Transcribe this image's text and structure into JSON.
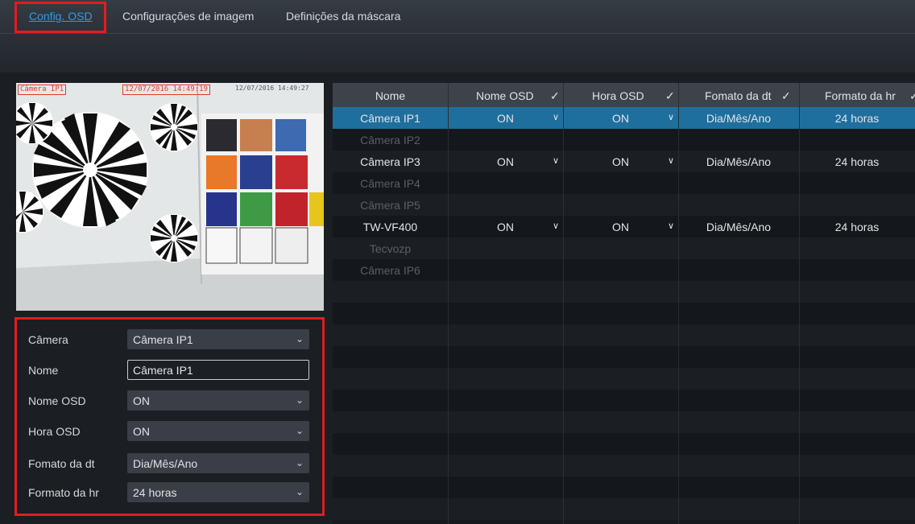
{
  "tabs": [
    {
      "label": "Config. OSD",
      "active": true
    },
    {
      "label": "Configurações de imagem",
      "active": false
    },
    {
      "label": "Definições da máscara",
      "active": false
    }
  ],
  "preview": {
    "osd_name": "Câmera IP1",
    "osd_time": "12/07/2016 14:49:19",
    "camera_timestamp": "12/07/2016 14:49:27"
  },
  "form": {
    "camera": {
      "label": "Câmera",
      "value": "Câmera IP1"
    },
    "name": {
      "label": "Nome",
      "value": "Câmera IP1"
    },
    "osd_name": {
      "label": "Nome OSD",
      "value": "ON"
    },
    "osd_time": {
      "label": "Hora OSD",
      "value": "ON"
    },
    "date_format": {
      "label": "Fomato da dt",
      "value": "Dia/Mês/Ano"
    },
    "time_format": {
      "label": "Formato da hr",
      "value": "24 horas"
    }
  },
  "table": {
    "headers": [
      "Nome",
      "Nome OSD",
      "Hora OSD",
      "Fomato da dt",
      "Formato da hr"
    ],
    "rows": [
      {
        "name": "Câmera IP1",
        "osd_name": "ON",
        "osd_time": "ON",
        "date_format": "Dia/Mês/Ano",
        "time_format": "24 horas",
        "selected": true,
        "online": true
      },
      {
        "name": "Câmera IP2",
        "osd_name": "",
        "osd_time": "",
        "date_format": "",
        "time_format": "",
        "selected": false,
        "online": false
      },
      {
        "name": "Câmera IP3",
        "osd_name": "ON",
        "osd_time": "ON",
        "date_format": "Dia/Mês/Ano",
        "time_format": "24 horas",
        "selected": false,
        "online": true
      },
      {
        "name": "Câmera IP4",
        "osd_name": "",
        "osd_time": "",
        "date_format": "",
        "time_format": "",
        "selected": false,
        "online": false
      },
      {
        "name": "Câmera IP5",
        "osd_name": "",
        "osd_time": "",
        "date_format": "",
        "time_format": "",
        "selected": false,
        "online": false
      },
      {
        "name": "TW-VF400",
        "osd_name": "ON",
        "osd_time": "ON",
        "date_format": "Dia/Mês/Ano",
        "time_format": "24 horas",
        "selected": false,
        "online": true
      },
      {
        "name": "Tecvozp",
        "osd_name": "",
        "osd_time": "",
        "date_format": "",
        "time_format": "",
        "selected": false,
        "online": false
      },
      {
        "name": "Câmera IP6",
        "osd_name": "",
        "osd_time": "",
        "date_format": "",
        "time_format": "",
        "selected": false,
        "online": false
      }
    ]
  },
  "colors": {
    "accent": "#2f9ae8",
    "highlight": "#e11c24",
    "selected_row": "#1f6f9e",
    "offline_text": "#5a5f66"
  }
}
